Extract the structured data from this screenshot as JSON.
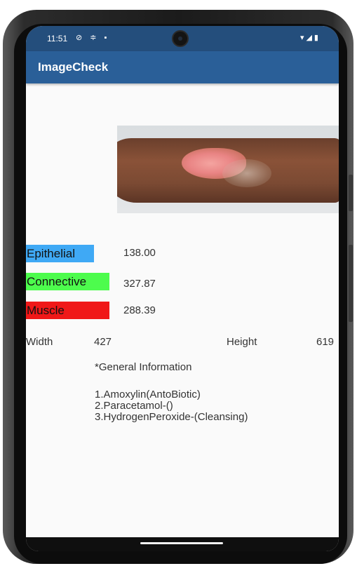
{
  "status_bar": {
    "time": "11:51",
    "left_icons": "⊘ ≑ ▪",
    "right_icons": "▾◢▮"
  },
  "app_bar": {
    "title": "ImageCheck"
  },
  "tissues": [
    {
      "label": "Epithelial",
      "value": "138.00",
      "color": "#3fa9f5"
    },
    {
      "label": "Connective",
      "value": "327.87",
      "color": "#4dfc4d"
    },
    {
      "label": "Muscle",
      "value": "288.39",
      "color": "#f01818"
    }
  ],
  "dimensions": {
    "width_label": "Width",
    "width_value": "427",
    "height_label": "Height",
    "height_value": "619"
  },
  "general_info": {
    "heading": "*General Information",
    "items": [
      "1.Amoxylin(AntoBiotic)",
      "2.Paracetamol-()",
      "3.HydrogenPeroxide-(Cleansing)"
    ]
  }
}
